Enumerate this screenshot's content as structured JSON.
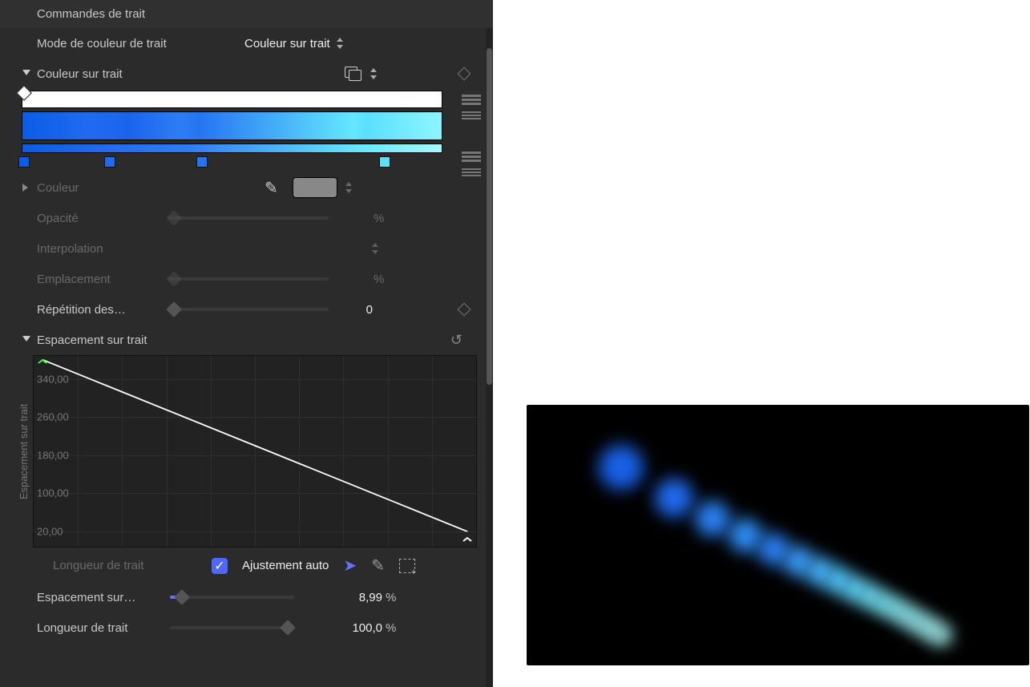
{
  "panel": {
    "sectionTitle": "Commandes de trait",
    "colorMode": {
      "label": "Mode de couleur de trait",
      "value": "Couleur sur trait"
    },
    "colorOverStroke": {
      "header": "Couleur sur trait"
    },
    "color": {
      "label": "Couleur"
    },
    "opacity": {
      "label": "Opacité",
      "unit": "%"
    },
    "interpolation": {
      "label": "Interpolation"
    },
    "location": {
      "label": "Emplacement",
      "unit": "%"
    },
    "repetition": {
      "label": "Répétition des…",
      "value": "0"
    },
    "spacing": {
      "header": "Espacement sur trait",
      "axisLabel": "Espacement sur trait",
      "xLabel": "Longueur de trait"
    },
    "autofit": {
      "label": "Ajustement auto"
    },
    "spacingOn": {
      "label": "Espacement sur…",
      "value": "8,99",
      "unit": "%"
    },
    "strokeLen": {
      "label": "Longueur de trait",
      "value": "100,0",
      "unit": "%"
    }
  },
  "chart_data": {
    "type": "line",
    "title": "Espacement sur trait",
    "xlabel": "Longueur de trait",
    "ylabel": "Espacement sur trait",
    "ylim": [
      20,
      380
    ],
    "yticks": [
      20,
      100,
      180,
      260,
      340
    ],
    "ytick_labels": [
      "20,00",
      "100,00",
      "180,00",
      "260,00",
      "340,00"
    ],
    "x": [
      0,
      100
    ],
    "values": [
      380,
      20
    ]
  },
  "gradientStops": [
    {
      "pos": 0,
      "color": "#0b5ce6"
    },
    {
      "pos": 20,
      "color": "#1f6af0"
    },
    {
      "pos": 42,
      "color": "#2574f2"
    },
    {
      "pos": 85,
      "color": "#5adfff"
    }
  ]
}
